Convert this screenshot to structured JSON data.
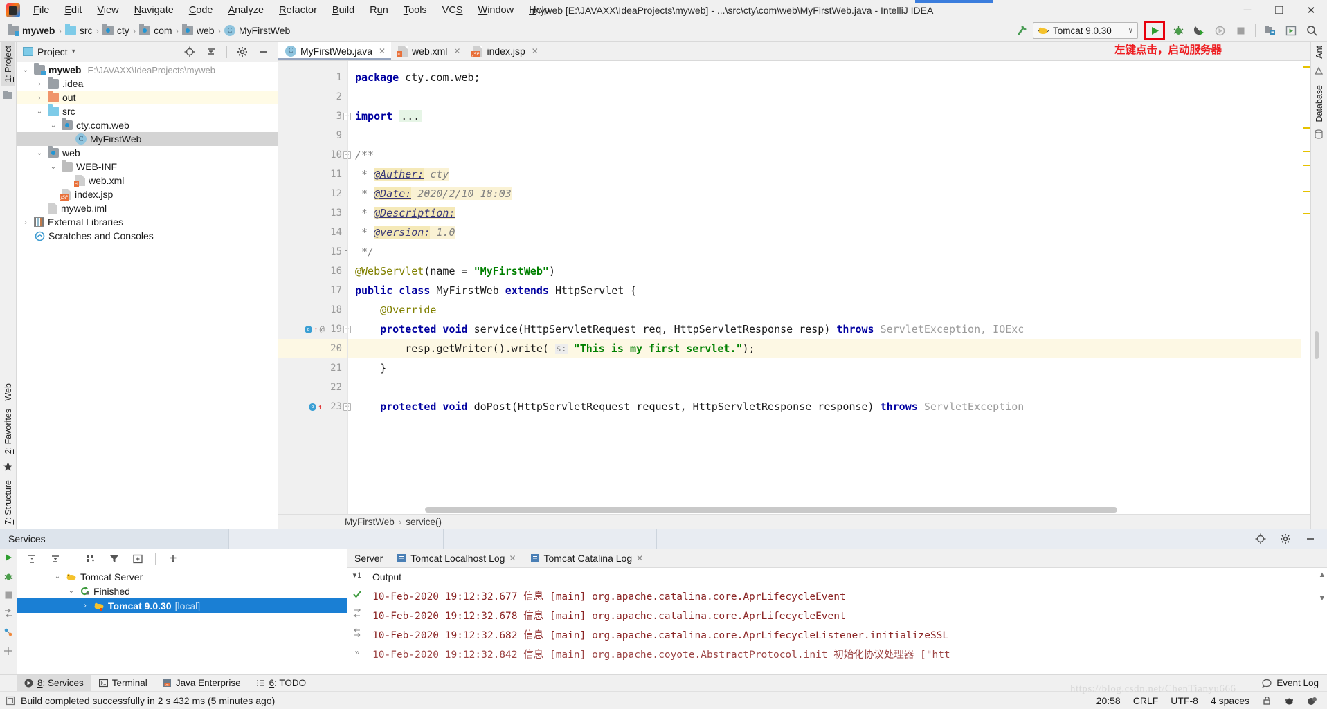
{
  "window": {
    "title": "myweb [E:\\JAVAXX\\IdeaProjects\\myweb] - ...\\src\\cty\\com\\web\\MyFirstWeb.java - IntelliJ IDEA",
    "minimize": "─",
    "maximize": "❐",
    "close": "✕"
  },
  "menubar": {
    "items": [
      {
        "pre": "",
        "acc": "F",
        "post": "ile"
      },
      {
        "pre": "",
        "acc": "E",
        "post": "dit"
      },
      {
        "pre": "",
        "acc": "V",
        "post": "iew"
      },
      {
        "pre": "",
        "acc": "N",
        "post": "avigate"
      },
      {
        "pre": "",
        "acc": "C",
        "post": "ode"
      },
      {
        "pre": "",
        "acc": "A",
        "post": "nalyze"
      },
      {
        "pre": "",
        "acc": "R",
        "post": "efactor"
      },
      {
        "pre": "",
        "acc": "B",
        "post": "uild"
      },
      {
        "pre": "R",
        "acc": "u",
        "post": "n"
      },
      {
        "pre": "",
        "acc": "T",
        "post": "ools"
      },
      {
        "pre": "VC",
        "acc": "S",
        "post": ""
      },
      {
        "pre": "",
        "acc": "W",
        "post": "indow"
      },
      {
        "pre": "",
        "acc": "H",
        "post": "elp"
      }
    ]
  },
  "breadcrumb": {
    "items": [
      {
        "label": "myweb",
        "icon": "module-folder-icon",
        "bold": true
      },
      {
        "label": "src",
        "icon": "source-folder-icon",
        "bold": false
      },
      {
        "label": "cty",
        "icon": "package-folder-icon",
        "bold": false
      },
      {
        "label": "com",
        "icon": "package-folder-icon",
        "bold": false
      },
      {
        "label": "web",
        "icon": "package-folder-icon",
        "bold": false
      },
      {
        "label": "MyFirstWeb",
        "icon": "java-class-icon",
        "bold": false
      }
    ],
    "separator": "›"
  },
  "toolbar": {
    "run_config_label": "Tomcat 9.0.30",
    "run_config_chevron": "∨",
    "annotation_text": "左键点击，启动服务器",
    "buttons": [
      {
        "name": "build-hammer-icon",
        "title": "Build"
      },
      {
        "name": "run-button",
        "title": "Run"
      },
      {
        "name": "debug-button",
        "title": "Debug"
      },
      {
        "name": "run-with-coverage-button",
        "title": "Run with Coverage"
      },
      {
        "name": "profile-button",
        "title": "Profile"
      },
      {
        "name": "stop-button",
        "title": "Stop"
      },
      {
        "name": "update-application-button",
        "title": "Update"
      },
      {
        "name": "search-everywhere-icon",
        "title": "Search Everywhere"
      }
    ]
  },
  "left_strip": {
    "project_tab": {
      "pre": "",
      "acc": "1",
      "post": ": Project"
    },
    "structure_tab": {
      "pre": "",
      "acc": "7",
      "post": ": Structure"
    },
    "favorites_tab": {
      "pre": "",
      "acc": "2",
      "post": ": Favorites"
    },
    "web_tab": "Web"
  },
  "right_strip": {
    "ant_tab": "Ant",
    "database_tab": "Database"
  },
  "project_panel": {
    "title": "Project",
    "chevron": "▾",
    "tree": [
      {
        "indent": 0,
        "arrow": "⌄",
        "icon": "module-folder-icon",
        "label": "myweb",
        "bold": true,
        "path": "E:\\JAVAXX\\IdeaProjects\\myweb",
        "state": "normal"
      },
      {
        "indent": 1,
        "arrow": "›",
        "icon": "folder-gray-icon",
        "label": ".idea",
        "bold": false,
        "path": "",
        "state": "normal"
      },
      {
        "indent": 1,
        "arrow": "›",
        "icon": "folder-orange-icon",
        "label": "out",
        "bold": false,
        "path": "",
        "state": "highlight"
      },
      {
        "indent": 1,
        "arrow": "⌄",
        "icon": "source-folder-icon",
        "label": "src",
        "bold": false,
        "path": "",
        "state": "normal"
      },
      {
        "indent": 2,
        "arrow": "⌄",
        "icon": "package-folder-icon",
        "label": "cty.com.web",
        "bold": false,
        "path": "",
        "state": "normal"
      },
      {
        "indent": 3,
        "arrow": "",
        "icon": "java-class-icon",
        "label": "MyFirstWeb",
        "bold": false,
        "path": "",
        "state": "selected"
      },
      {
        "indent": 1,
        "arrow": "⌄",
        "icon": "web-folder-icon",
        "label": "web",
        "bold": false,
        "path": "",
        "state": "normal"
      },
      {
        "indent": 2,
        "arrow": "⌄",
        "icon": "folder-darkgray-icon",
        "label": "WEB-INF",
        "bold": false,
        "path": "",
        "state": "normal"
      },
      {
        "indent": 3,
        "arrow": "",
        "icon": "xml-file-icon",
        "label": "web.xml",
        "bold": false,
        "path": "",
        "state": "normal"
      },
      {
        "indent": 2,
        "arrow": "",
        "icon": "jsp-file-icon",
        "label": "index.jsp",
        "bold": false,
        "path": "",
        "state": "normal"
      },
      {
        "indent": 1,
        "arrow": "",
        "icon": "iml-file-icon",
        "label": "myweb.iml",
        "bold": false,
        "path": "",
        "state": "normal"
      },
      {
        "indent": 0,
        "arrow": "›",
        "icon": "external-libraries-icon",
        "label": "External Libraries",
        "bold": false,
        "path": "",
        "state": "normal"
      },
      {
        "indent": 0,
        "arrow": "",
        "icon": "scratches-icon",
        "label": "Scratches and Consoles",
        "bold": false,
        "path": "",
        "state": "normal"
      }
    ]
  },
  "editor": {
    "tabs": [
      {
        "label": "MyFirstWeb.java",
        "icon": "java-class-icon",
        "active": true,
        "close": "✕"
      },
      {
        "label": "web.xml",
        "icon": "xml-file-icon",
        "active": false,
        "close": "✕"
      },
      {
        "label": "index.jsp",
        "icon": "jsp-file-icon",
        "active": false,
        "close": "✕"
      }
    ],
    "lines": [
      {
        "num": "1",
        "tokens": [
          {
            "t": "package ",
            "c": "kw"
          },
          {
            "t": "cty.com.web;",
            "c": "plain"
          }
        ]
      },
      {
        "num": "2",
        "tokens": []
      },
      {
        "num": "3",
        "tokens": [
          {
            "t": "import ",
            "c": "kw"
          },
          {
            "t": "...",
            "c": "ellipsis"
          }
        ]
      },
      {
        "num": "9",
        "tokens": []
      },
      {
        "num": "10",
        "tokens": [
          {
            "t": "/**",
            "c": "cmt"
          }
        ]
      },
      {
        "num": "11",
        "tokens": [
          {
            "t": " * ",
            "c": "cmt"
          },
          {
            "t": "@Auther:",
            "c": "jdoc-tag"
          },
          {
            "t": " cty",
            "c": "jdoc-val"
          }
        ]
      },
      {
        "num": "12",
        "tokens": [
          {
            "t": " * ",
            "c": "cmt"
          },
          {
            "t": "@Date:",
            "c": "jdoc-tag"
          },
          {
            "t": " 2020/2/10 18:03",
            "c": "jdoc-val"
          }
        ]
      },
      {
        "num": "13",
        "tokens": [
          {
            "t": " * ",
            "c": "cmt"
          },
          {
            "t": "@Description:",
            "c": "jdoc-tag"
          }
        ]
      },
      {
        "num": "14",
        "tokens": [
          {
            "t": " * ",
            "c": "cmt"
          },
          {
            "t": "@version:",
            "c": "jdoc-tag"
          },
          {
            "t": " 1.0",
            "c": "jdoc-val"
          }
        ]
      },
      {
        "num": "15",
        "tokens": [
          {
            "t": " */",
            "c": "cmt"
          }
        ]
      },
      {
        "num": "16",
        "tokens": [
          {
            "t": "@WebServlet",
            "c": "anno"
          },
          {
            "t": "(name = ",
            "c": "plain"
          },
          {
            "t": "\"MyFirstWeb\"",
            "c": "str"
          },
          {
            "t": ")",
            "c": "plain"
          }
        ]
      },
      {
        "num": "17",
        "tokens": [
          {
            "t": "public class ",
            "c": "kw"
          },
          {
            "t": "MyFirstWeb ",
            "c": "plain"
          },
          {
            "t": "extends ",
            "c": "kw"
          },
          {
            "t": "HttpServlet {",
            "c": "plain"
          }
        ]
      },
      {
        "num": "18",
        "tokens": [
          {
            "t": "    ",
            "c": "plain"
          },
          {
            "t": "@Override",
            "c": "anno"
          }
        ]
      },
      {
        "num": "19",
        "tokens": [
          {
            "t": "    ",
            "c": "plain"
          },
          {
            "t": "protected void ",
            "c": "kw"
          },
          {
            "t": "service(HttpServletRequest req, HttpServletResponse resp) ",
            "c": "plain"
          },
          {
            "t": "throws ",
            "c": "kw"
          },
          {
            "t": "ServletException, IOExc",
            "c": "err"
          }
        ]
      },
      {
        "num": "20",
        "tokens": [
          {
            "t": "        resp.getWriter().write( ",
            "c": "plain"
          },
          {
            "t": "s:",
            "c": "hint"
          },
          {
            "t": " ",
            "c": "plain"
          },
          {
            "t": "\"This is my first servlet.\"",
            "c": "str"
          },
          {
            "t": ");",
            "c": "plain"
          }
        ]
      },
      {
        "num": "21",
        "tokens": [
          {
            "t": "    }",
            "c": "plain"
          }
        ]
      },
      {
        "num": "22",
        "tokens": []
      },
      {
        "num": "23",
        "tokens": [
          {
            "t": "    ",
            "c": "plain"
          },
          {
            "t": "protected void ",
            "c": "kw"
          },
          {
            "t": "doPost(HttpServletRequest request, HttpServletResponse response) ",
            "c": "plain"
          },
          {
            "t": "throws ",
            "c": "kw"
          },
          {
            "t": "ServletException",
            "c": "err"
          }
        ]
      }
    ],
    "current_line": "20",
    "bottom_breadcrumb": {
      "class": "MyFirstWeb",
      "method": "service()",
      "separator": "›"
    }
  },
  "services": {
    "title": "Services",
    "tree": [
      {
        "indent": 0,
        "arrow": "⌄",
        "icon": "tomcat-icon",
        "label": "Tomcat Server",
        "suffix": "",
        "selected": false
      },
      {
        "indent": 1,
        "arrow": "⌄",
        "icon": "finished-icon",
        "label": "Finished",
        "suffix": "",
        "selected": false
      },
      {
        "indent": 2,
        "arrow": "›",
        "icon": "tomcat-icon",
        "label": "Tomcat 9.0.30",
        "suffix": "[local]",
        "selected": true
      }
    ],
    "console_tabs": [
      {
        "label": "Server",
        "icon": "",
        "active": false,
        "close": ""
      },
      {
        "label": "Tomcat Localhost Log",
        "icon": "log-icon",
        "active": false,
        "close": "✕"
      },
      {
        "label": "Tomcat Catalina Log",
        "icon": "log-icon",
        "active": false,
        "close": "✕"
      }
    ],
    "output_label": "Output",
    "output_lines": [
      "10-Feb-2020 19:12:32.677 信息 [main] org.apache.catalina.core.AprLifecycleEvent",
      "10-Feb-2020 19:12:32.678 信息 [main] org.apache.catalina.core.AprLifecycleEvent",
      "10-Feb-2020 19:12:32.682 信息 [main] org.apache.catalina.core.AprLifecycleListener.initializeSSL",
      "10-Feb-2020 19:12:32.842 信息 [main] org.apache.coyote.AbstractProtocol.init 初始化协议处理器 [\"htt"
    ],
    "filter_count": "1"
  },
  "tool_window_bar": {
    "tabs": [
      {
        "pre": "",
        "acc": "8",
        "post": ": Services",
        "icon": "services-icon",
        "selected": true
      },
      {
        "pre": "Terminal",
        "acc": "",
        "post": "",
        "icon": "terminal-icon",
        "selected": false
      },
      {
        "pre": "Java Enterprise",
        "acc": "",
        "post": "",
        "icon": "java-enterprise-icon",
        "selected": false
      },
      {
        "pre": "",
        "acc": "6",
        "post": ": TODO",
        "icon": "todo-icon",
        "selected": false
      }
    ],
    "event_log": "Event Log"
  },
  "statusbar": {
    "message": "Build completed successfully in 2 s 432 ms (5 minutes ago)",
    "time": "20:58",
    "line_separator": "CRLF",
    "encoding": "UTF-8",
    "indent": "4 spaces",
    "watermark": "https://blog.csdn.net/ChenTianyu666"
  },
  "colors": {
    "accent_blue": "#1a7fd4",
    "run_green": "#499c54",
    "annotation_red": "#ee1c20",
    "log_red": "#8b2525",
    "selection_gray": "#d4d4d4"
  }
}
